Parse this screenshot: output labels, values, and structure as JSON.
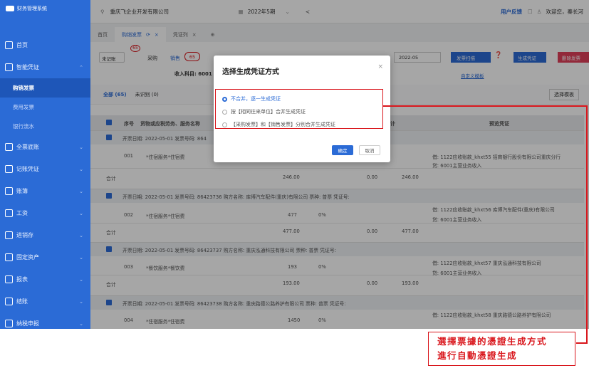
{
  "app": {
    "name": "财务管理系统",
    "company": "重庆飞企业开发有限公司",
    "period": "2022年5期",
    "feedback": "用户反馈",
    "welcome": "欢迎您，秦长河"
  },
  "sidebar": {
    "items": [
      {
        "label": "首页"
      },
      {
        "label": "智能凭证"
      },
      {
        "label": "购销发票",
        "sub": true,
        "active": true
      },
      {
        "label": "费用发票",
        "sub": true
      },
      {
        "label": "银行流水",
        "sub": true
      },
      {
        "label": "全票底账"
      },
      {
        "label": "记账凭证"
      },
      {
        "label": "账簿"
      },
      {
        "label": "工资"
      },
      {
        "label": "进销存"
      },
      {
        "label": "固定资产"
      },
      {
        "label": "报表"
      },
      {
        "label": "结账"
      },
      {
        "label": "纳税申报"
      }
    ]
  },
  "tabs": [
    {
      "label": "首页"
    },
    {
      "label": "购销发票",
      "active": true
    },
    {
      "label": "凭证列"
    }
  ],
  "filters": {
    "status": "未记账",
    "badge": "65",
    "purchase": "采购",
    "sales": "销售",
    "sales_count": "65",
    "subject": "收入科目: 6001",
    "date": "2022-05",
    "scan": "发票扫描",
    "generate": "生成凭证",
    "delete": "删除发票",
    "custom": "自定义模板",
    "template": "选择模板"
  },
  "subtabs": {
    "all": "全部 (65)",
    "unrecognized": "未识别 (0)"
  },
  "table": {
    "headers": [
      "序号",
      "货物或应税劳务、服务名称",
      "价税合计",
      "预览凭证"
    ],
    "groups": [
      {
        "info": "开票日期: 2022-05-01  发票号码: 864",
        "seq": "001",
        "item": "*住宿服务*住宿费",
        "amount": "",
        "tax": "",
        "total_amt": "246.00",
        "tax_total": "0.00",
        "grand": "246.00",
        "debit": "借: 1122应收账款_khxt55 招商银行股份有限公司重庆分行",
        "credit": "贷: 6001主营业务收入"
      },
      {
        "info": "开票日期: 2022-05-01  发票号码: 86423736  购方名称: 库博汽车配件(重庆)有限公司  票种: 普票  凭证号:",
        "seq": "002",
        "item": "*住宿服务*住宿费",
        "amount": "477",
        "tax": "0%",
        "total_amt": "477.00",
        "tax_total": "0.00",
        "grand": "477.00",
        "debit": "借: 1122应收账款_khxt56 库博汽车配件(重庆)有限公司",
        "credit": "贷: 6001主营业务收入"
      },
      {
        "info": "开票日期: 2022-05-01  发票号码: 86423737  购方名称: 重庆泓通科技有限公司  票种: 普票  凭证号:",
        "seq": "003",
        "item": "*餐饮服务*餐饮费",
        "amount": "193",
        "tax": "0%",
        "total_amt": "193.00",
        "tax_total": "0.00",
        "grand": "193.00",
        "debit": "借: 1122应收账款_khxt57 重庆泓通科技有限公司",
        "credit": "贷: 6001主营业务收入"
      },
      {
        "info": "开票日期: 2022-05-01  发票号码: 86423738  购方名称: 重庆路德公路养护有限公司  票种: 普票  凭证号:",
        "seq": "004",
        "item": "*住宿服务*住宿费",
        "amount": "1450",
        "tax": "0%",
        "total_amt": "",
        "tax_total": "",
        "grand": "",
        "debit": "借: 1122应收账款_khxt58 重庆路德公路养护有限公司",
        "credit": ""
      }
    ],
    "subtotal_label": "合计"
  },
  "modal": {
    "title": "选择生成凭证方式",
    "options": [
      "不合并，逐一生成凭证",
      "按【相同往来单位】合并生成凭证",
      "【采购发票】和【销售发票】分别合并生成凭证"
    ],
    "confirm": "确定",
    "cancel": "取消"
  },
  "callout": {
    "line1": "選擇票據的憑證生成方式",
    "line2": "進行自動憑證生成"
  }
}
